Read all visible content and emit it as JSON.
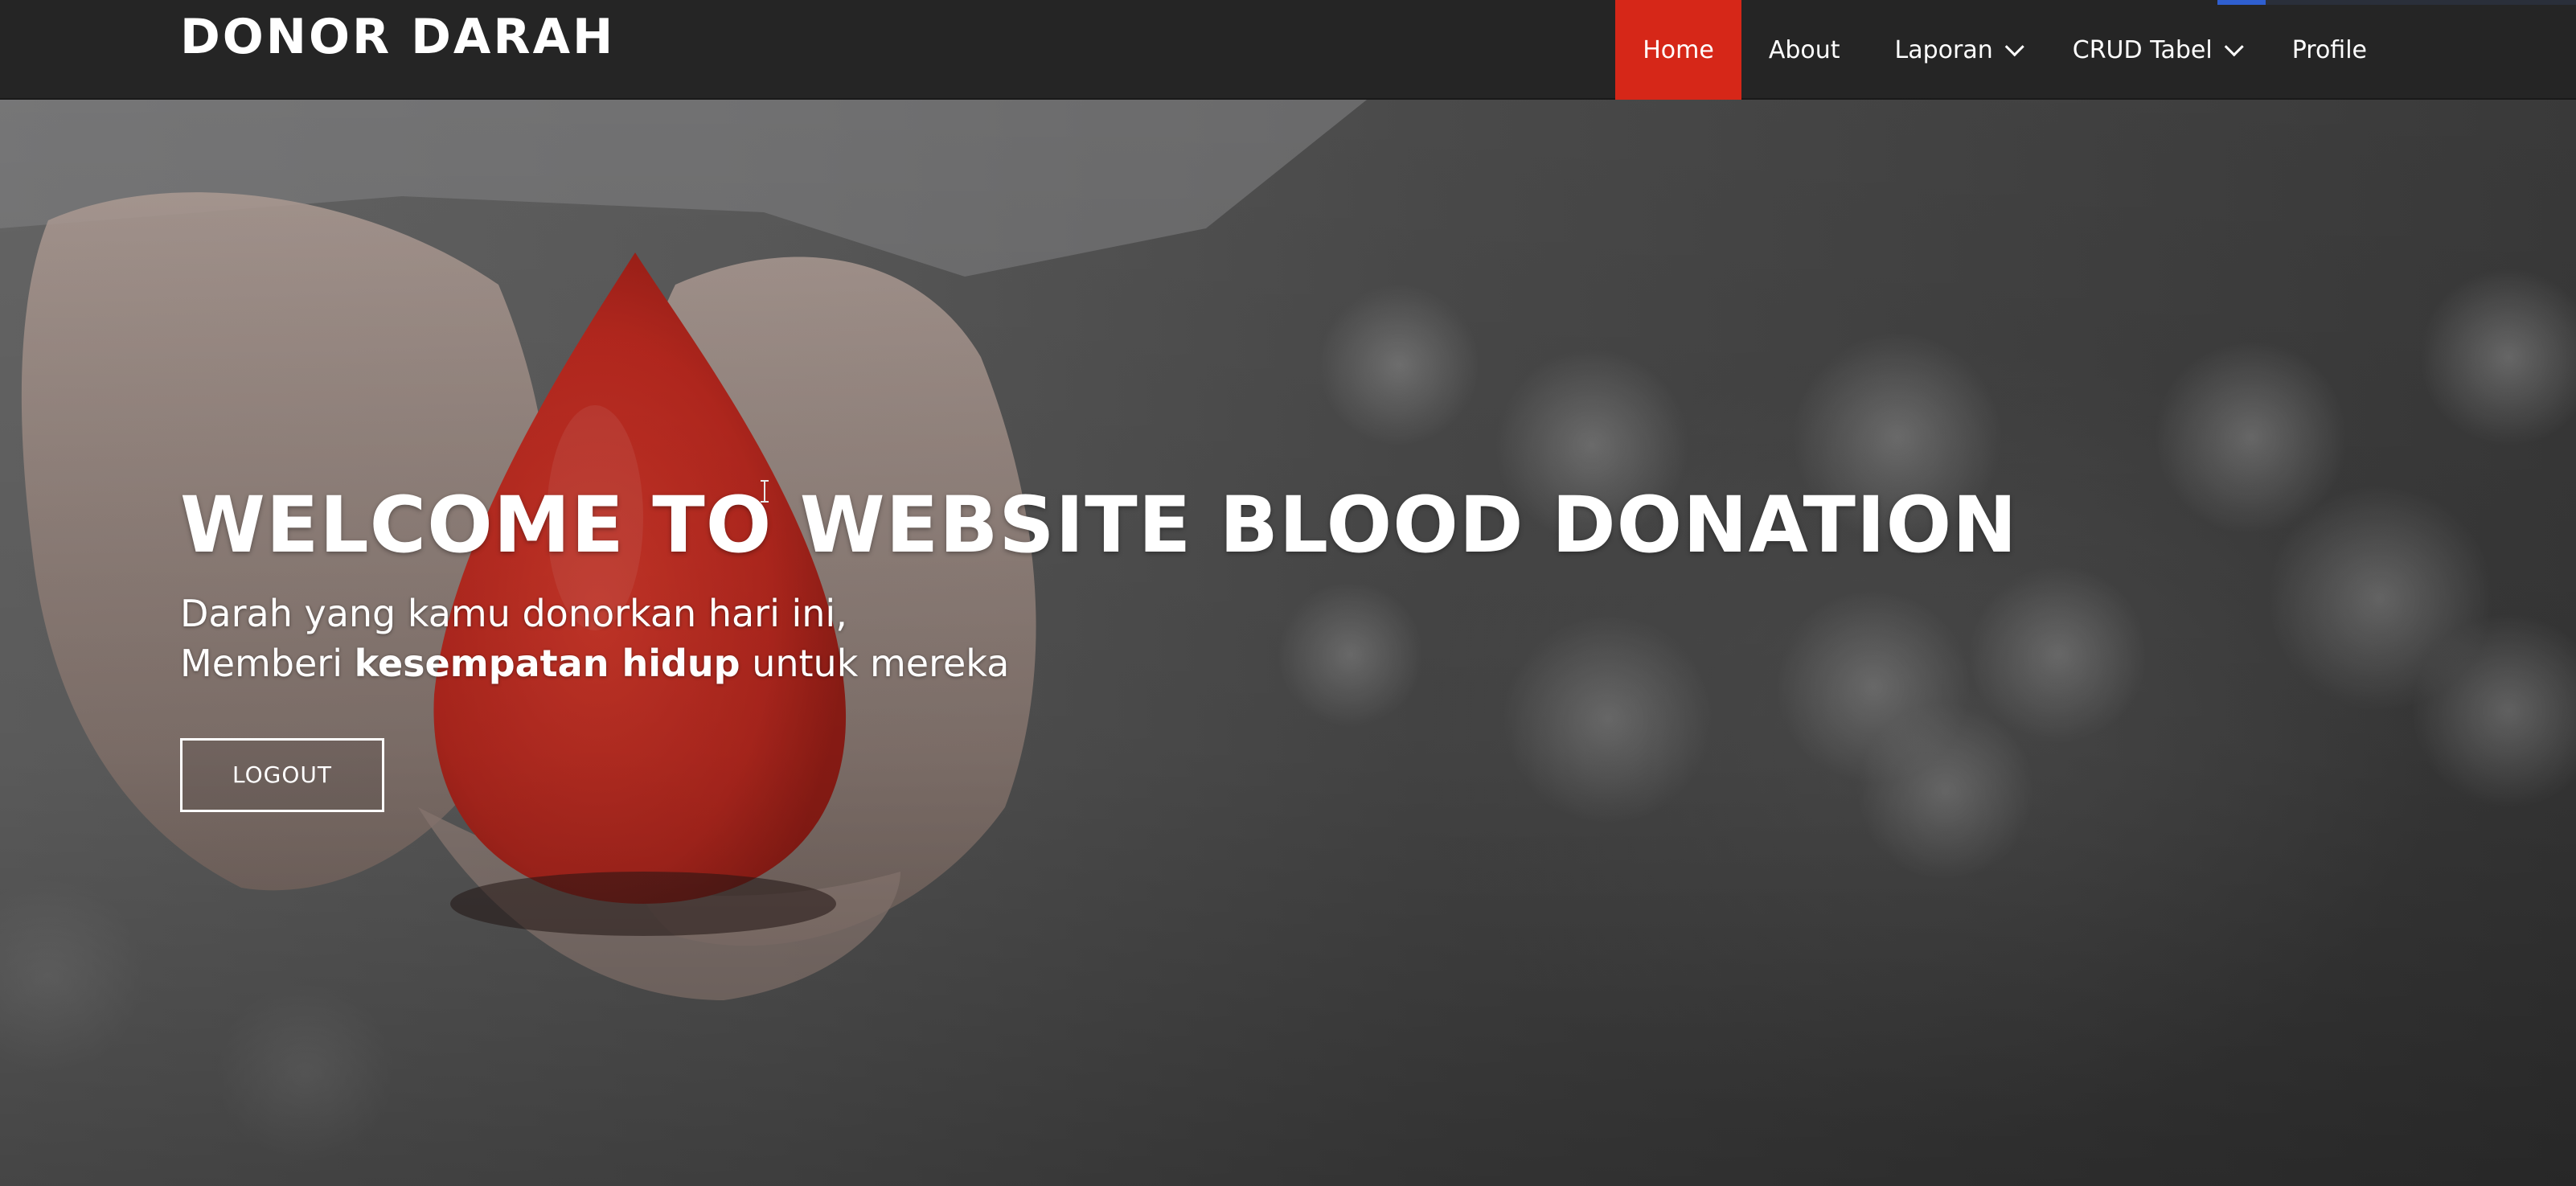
{
  "header": {
    "brand": "DONOR DARAH",
    "nav": [
      {
        "label": "Home",
        "active": true,
        "has_dropdown": false
      },
      {
        "label": "About",
        "active": false,
        "has_dropdown": false
      },
      {
        "label": "Laporan",
        "active": false,
        "has_dropdown": true
      },
      {
        "label": "CRUD Tabel",
        "active": false,
        "has_dropdown": true
      },
      {
        "label": "Profile",
        "active": false,
        "has_dropdown": false
      }
    ]
  },
  "hero": {
    "title": "WELCOME TO WEBSITE BLOOD DONATION",
    "line1": "Darah yang kamu donorkan hari ini,",
    "line2_before": "Memberi ",
    "line2_bold": "kesempatan hidup",
    "line2_after": " untuk mereka",
    "button_label": "LOGOUT"
  },
  "colors": {
    "nav_background": "#252525",
    "active_tab": "#d62718",
    "blood_drop": "#c8281e",
    "text": "#ffffff"
  },
  "icons": [
    "chevron-down-icon",
    "blood-drop-icon",
    "text-cursor-icon"
  ]
}
